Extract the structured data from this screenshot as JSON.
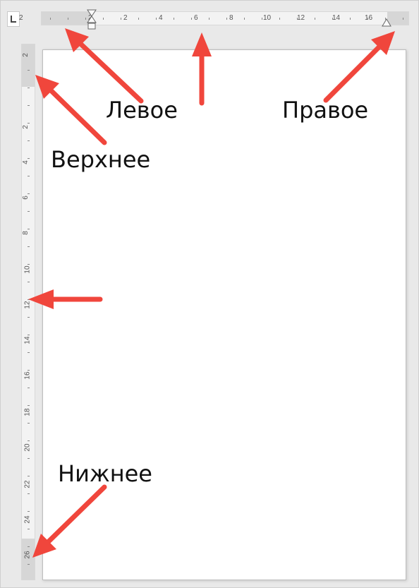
{
  "rulers": {
    "horizontal_ticks": [
      "2",
      "2",
      "2",
      "4",
      "6",
      "8",
      "10",
      "12",
      "14",
      "16"
    ],
    "vertical_ticks": [
      "2",
      "2",
      "4",
      "6",
      "8",
      "10",
      "12",
      "14",
      "16",
      "18",
      "20",
      "22",
      "24",
      "26"
    ]
  },
  "annotations": {
    "left": "Левое",
    "right": "Правое",
    "top": "Верхнее",
    "bottom": "Нижнее"
  },
  "colors": {
    "arrow": "#f0463c",
    "ruler_bg": "#f3f3f3",
    "margin_zone": "#d6d6d6",
    "page": "#ffffff"
  },
  "icons": {
    "tab_selector": "tab-stop-left-icon",
    "first_line_indent": "first-line-indent-marker-icon",
    "right_indent": "right-indent-marker-icon",
    "arrow": "red-arrow-icon"
  }
}
